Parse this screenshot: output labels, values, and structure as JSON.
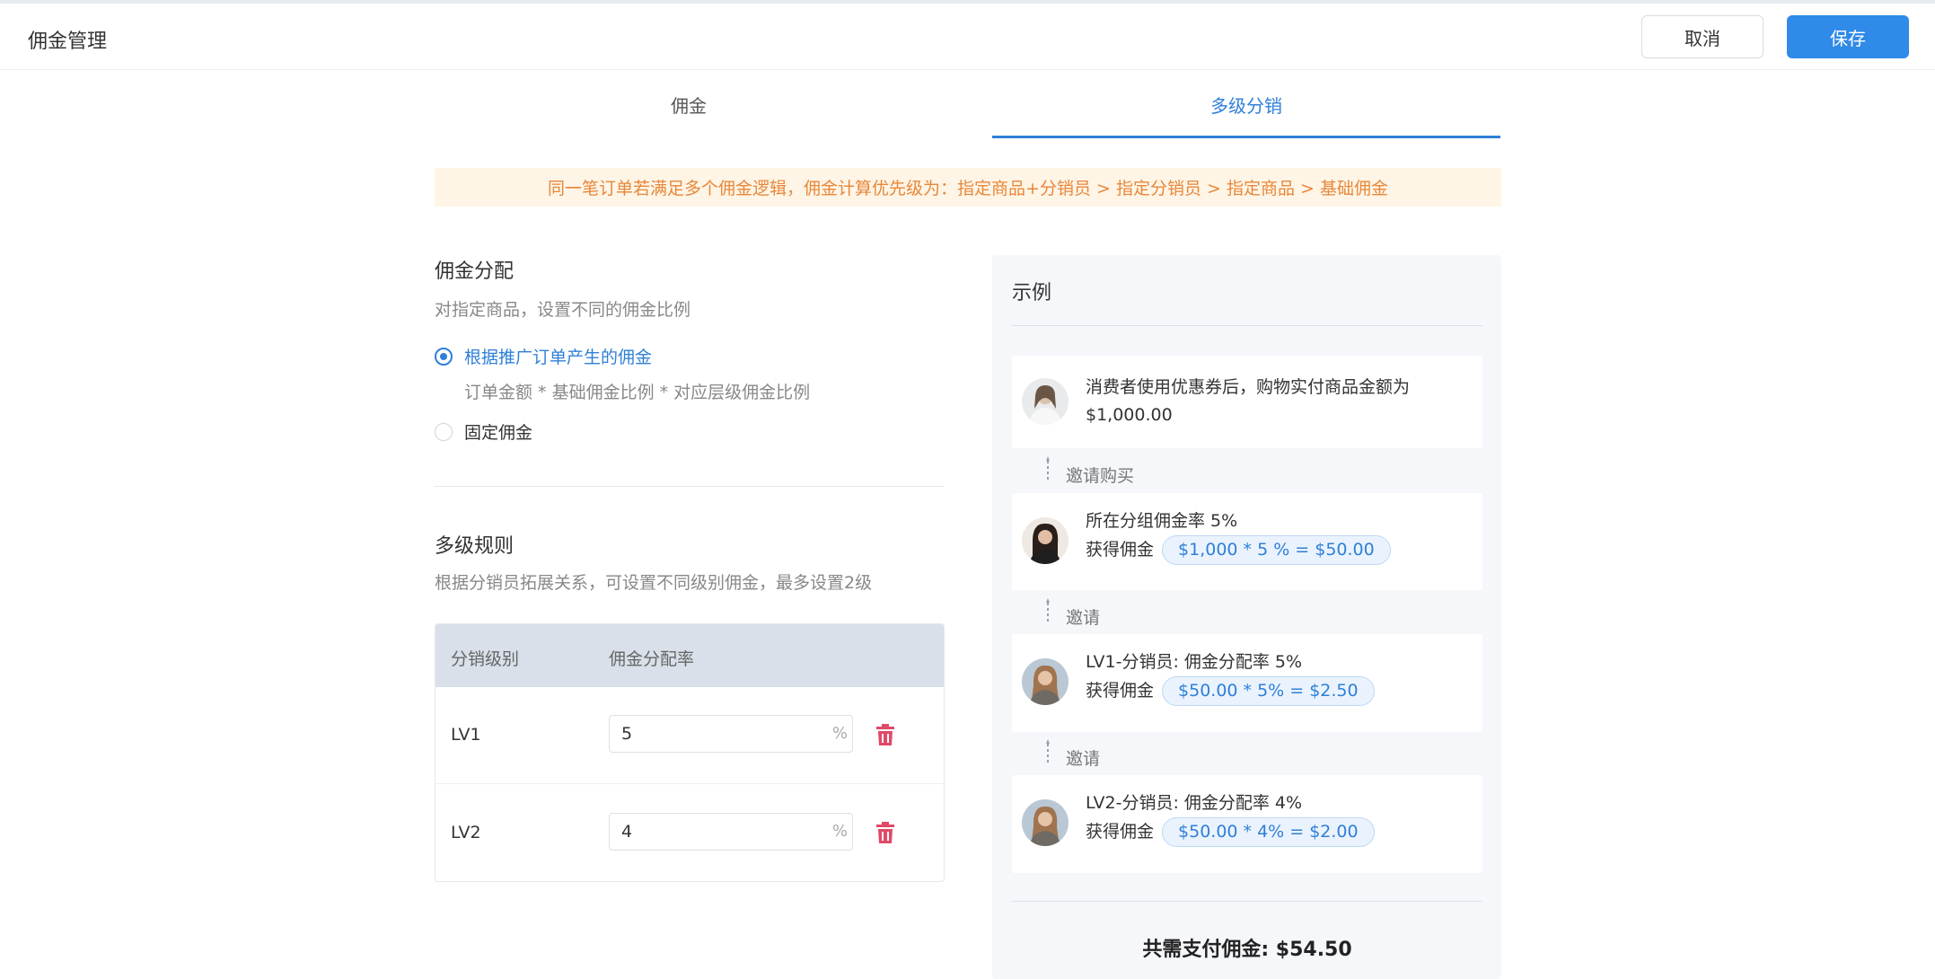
{
  "header": {
    "title": "佣金管理",
    "cancel_label": "取消",
    "save_label": "保存"
  },
  "tabs": [
    {
      "label": "佣金",
      "active": false
    },
    {
      "label": "多级分销",
      "active": true
    }
  ],
  "notice": "同一笔订单若满足多个佣金逻辑，佣金计算优先级为：指定商品+分销员 > 指定分销员 > 指定商品 > 基础佣金",
  "allocation": {
    "title": "佣金分配",
    "desc": "对指定商品，设置不同的佣金比例",
    "options": [
      {
        "label": "根据推广订单产生的佣金",
        "sub": "订单金额 * 基础佣金比例 * 对应层级佣金比例",
        "checked": true
      },
      {
        "label": "固定佣金",
        "checked": false
      }
    ]
  },
  "rules": {
    "title": "多级规则",
    "desc": "根据分销员拓展关系，可设置不同级别佣金，最多设置2级",
    "columns": [
      "分销级别",
      "佣金分配率"
    ],
    "rows": [
      {
        "level": "LV1",
        "rate": "5",
        "unit": "%"
      },
      {
        "level": "LV2",
        "rate": "4",
        "unit": "%"
      }
    ]
  },
  "example": {
    "title": "示例",
    "consumer": {
      "line1": "消费者使用优惠券后，购物实付商品金额为",
      "line2": "$1,000.00"
    },
    "invite_buy": "邀请购买",
    "group": {
      "line1": "所在分组佣金率 5%",
      "earn_label": "获得佣金",
      "formula": "$1,000 * 5 % = $50.00"
    },
    "invite_1": "邀请",
    "lv1": {
      "line1": "LV1-分销员: 佣金分配率 5%",
      "earn_label": "获得佣金",
      "formula": "$50.00 * 5% = $2.50"
    },
    "invite_2": "邀请",
    "lv2": {
      "line1": "LV2-分销员: 佣金分配率 4%",
      "earn_label": "获得佣金",
      "formula": "$50.00 * 4% = $2.00"
    },
    "total": "共需支付佣金: $54.50"
  },
  "colors": {
    "primary": "#2f8ae8",
    "active_tab": "#2f7fd8",
    "notice_bg": "#fef5e6",
    "notice_text": "#e8873a",
    "delete": "#e04a67",
    "table_header_bg": "#d9e0ea"
  }
}
